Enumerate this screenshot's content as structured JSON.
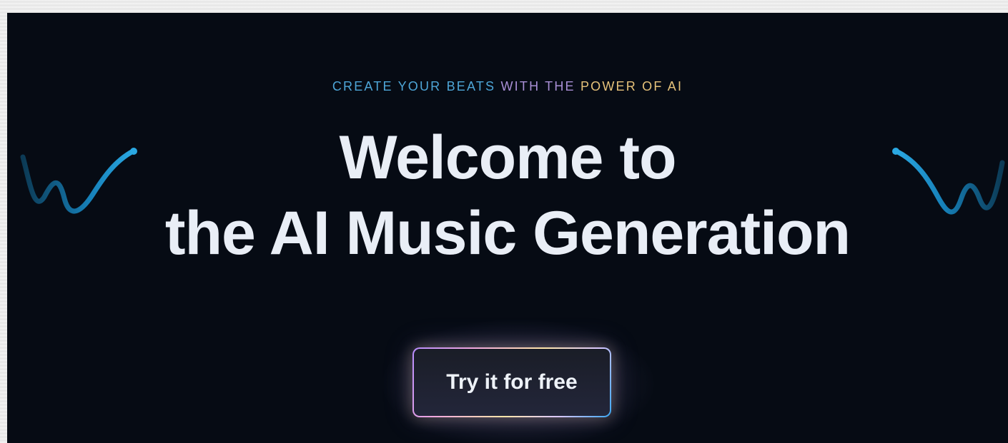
{
  "hero": {
    "tagline": {
      "part1": "CREATE YOUR BEATS",
      "part2": "WITH THE",
      "part3": "POWER OF AI"
    },
    "title_line1": "Welcome to",
    "title_line2": "the AI Music Generation",
    "cta_label": "Try it for free"
  },
  "colors": {
    "background": "#060b14",
    "title": "#e9eef6",
    "tagline_blue": "#4ea6d8",
    "tagline_violet": "#a98fd6",
    "tagline_gold": "#e6c27a",
    "wave": "#1f8fc8"
  },
  "icons": {
    "left_decoration": "sound-wave-icon",
    "right_decoration": "sound-wave-icon"
  }
}
